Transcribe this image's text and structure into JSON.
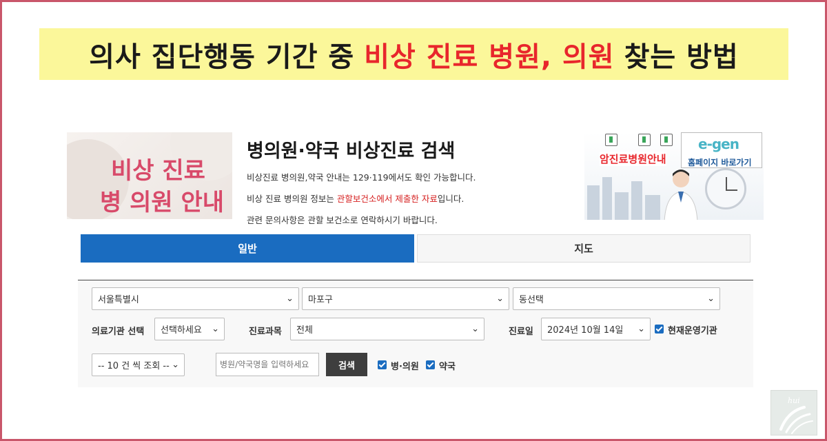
{
  "headline": {
    "part1": "의사 집단행동 기간 중",
    "part2": "비상 진료 병원, 의원",
    "part3": "찾는 방법"
  },
  "banner_left": {
    "line1": "비상 진료",
    "line2": "병 의원 안내"
  },
  "page_title": "병의원·약국 비상진료 검색",
  "info": {
    "line1": "비상진료 병의원,약국 안내는 129·119에서도 확인 가능합니다.",
    "line2_pre": "비상 진료 병의원 정보는 ",
    "line2_red": "관할보건소에서 제출한 자료",
    "line2_post": "입니다.",
    "line3": "관련 문의사항은 관할 보건소로 연락하시기 바랍니다."
  },
  "banner_right": {
    "cancer_label": "암진료병원안내",
    "logo_text": "e-gen",
    "home_label": "홈페이지 바로가기"
  },
  "tabs": {
    "general": "일반",
    "map": "지도"
  },
  "filters": {
    "city": "서울특별시",
    "district": "마포구",
    "dong": "동선택",
    "institution_label": "의료기관 선택",
    "institution_value": "선택하세요",
    "department_label": "진료과목",
    "department_value": "전체",
    "date_label": "진료일",
    "date_value": "2024년 10월 14일",
    "operating_label": "현재운영기관",
    "page_size": "-- 10 건 씩 조회 --",
    "name_placeholder": "병원/약국명을 입력하세요",
    "search_button": "검색",
    "hospital_label": "병·의원",
    "pharmacy_label": "약국"
  },
  "corner_logo": "hui",
  "icons": {
    "chevron": "chevron-down-icon",
    "check": "check-icon"
  },
  "colors": {
    "accent_blue": "#1a6cc0",
    "headline_red": "#e8262c",
    "headline_bg": "#fbf79a",
    "frame": "#c9566a"
  }
}
